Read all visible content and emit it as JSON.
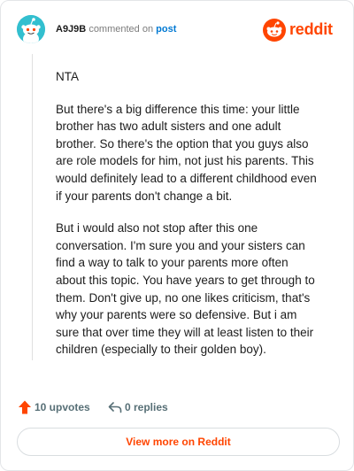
{
  "comment": {
    "username": "A9J9B",
    "commented_text": "commented on",
    "post_link": "post",
    "paragraphs": [
      "NTA",
      "But there's a big difference this time: your little brother has two adult sisters and one adult brother. So there's the option that you guys also are role models for him, not just his parents. This would definitely lead to a different childhood even if your parents don't change a bit.",
      "But i would also not stop after this one conversation. I'm sure you and your sisters can find a way to talk to your parents more often about this topic. You have years to get through to them. Don't give up, no one likes criticism, that's why your parents were so defensive. But i am sure that over time they will at least listen to their children (especially to their golden boy)."
    ]
  },
  "brand": {
    "name": "reddit",
    "color": "#ff4500",
    "icon": "reddit-snoo-icon"
  },
  "actions": {
    "upvotes": "10 upvotes",
    "upvote_icon": "upvote-arrow-icon",
    "upvote_color": "#ff4500",
    "replies": "0 replies",
    "reply_icon": "reply-arrow-icon"
  },
  "footer": {
    "view_more": "View more on Reddit"
  },
  "avatar": {
    "icon": "snoo-avatar-icon",
    "color": "#33bfcf"
  }
}
